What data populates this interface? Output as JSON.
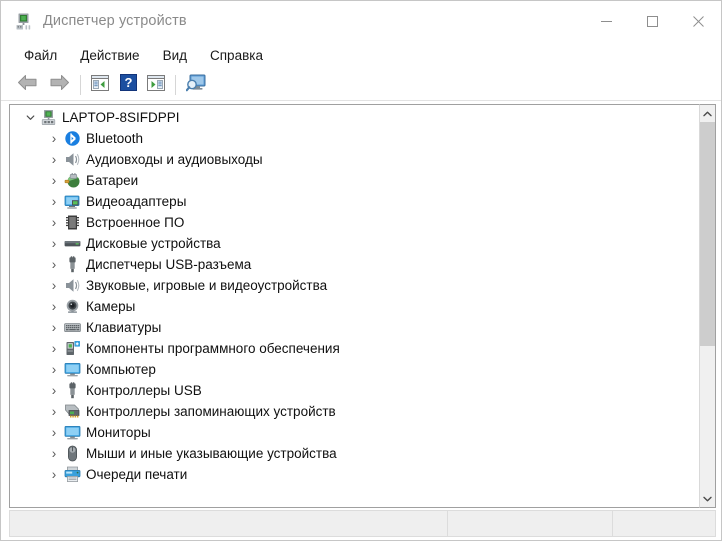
{
  "window": {
    "title": "Диспетчер устройств",
    "icon": "device-manager-icon",
    "controls": {
      "minimize": "minimize-icon",
      "maximize": "maximize-icon",
      "close": "close-icon"
    }
  },
  "menubar": {
    "items": [
      {
        "label": "Файл",
        "name": "menu-file"
      },
      {
        "label": "Действие",
        "name": "menu-action"
      },
      {
        "label": "Вид",
        "name": "menu-view"
      },
      {
        "label": "Справка",
        "name": "menu-help"
      }
    ]
  },
  "toolbar": {
    "buttons": [
      {
        "name": "back-arrow-icon",
        "title": "Назад"
      },
      {
        "name": "forward-arrow-icon",
        "title": "Вперед"
      },
      {
        "name": "show-hide-console-tree-icon",
        "title": "Показать/скрыть дерево консоли"
      },
      {
        "name": "help-icon",
        "title": "Справка"
      },
      {
        "name": "properties-icon",
        "title": "Свойства"
      },
      {
        "name": "scan-hardware-changes-icon",
        "title": "Обновить конфигурацию оборудования"
      }
    ]
  },
  "tree": {
    "root": {
      "label": "LAPTOP-8SIFDPPI",
      "icon": "computer-node-icon",
      "expanded": true
    },
    "items": [
      {
        "label": "Bluetooth",
        "icon": "bluetooth-icon"
      },
      {
        "label": "Аудиовходы и аудиовыходы",
        "icon": "audio-io-icon"
      },
      {
        "label": "Батареи",
        "icon": "battery-icon"
      },
      {
        "label": "Видеоадаптеры",
        "icon": "display-adapter-icon"
      },
      {
        "label": "Встроенное ПО",
        "icon": "firmware-icon"
      },
      {
        "label": "Дисковые устройства",
        "icon": "disk-drive-icon"
      },
      {
        "label": "Диспетчеры USB-разъема",
        "icon": "usb-connector-icon"
      },
      {
        "label": "Звуковые, игровые и видеоустройства",
        "icon": "sound-video-icon"
      },
      {
        "label": "Камеры",
        "icon": "camera-icon"
      },
      {
        "label": "Клавиатуры",
        "icon": "keyboard-icon"
      },
      {
        "label": "Компоненты программного обеспечения",
        "icon": "software-component-icon"
      },
      {
        "label": "Компьютер",
        "icon": "computer-icon"
      },
      {
        "label": "Контроллеры USB",
        "icon": "usb-controller-icon"
      },
      {
        "label": "Контроллеры запоминающих устройств",
        "icon": "storage-controller-icon"
      },
      {
        "label": "Мониторы",
        "icon": "monitor-icon"
      },
      {
        "label": "Мыши и иные указывающие устройства",
        "icon": "mouse-icon"
      },
      {
        "label": "Очереди печати",
        "icon": "print-queue-icon"
      }
    ],
    "collapsed_chevron": "›"
  },
  "scrollbar": {
    "up": "scroll-up-icon",
    "down": "scroll-down-icon",
    "thumb_top_percent": 0,
    "thumb_height_percent": 61
  },
  "statusbar": {
    "pane1": "",
    "pane2": "",
    "pane3": ""
  },
  "colors": {
    "accent": "#0078d7",
    "bluetooth": "#1a7fe0",
    "window_bg": "#ffffff",
    "status_bg": "#efefef",
    "scrollbar_thumb": "#cdcdcd"
  }
}
